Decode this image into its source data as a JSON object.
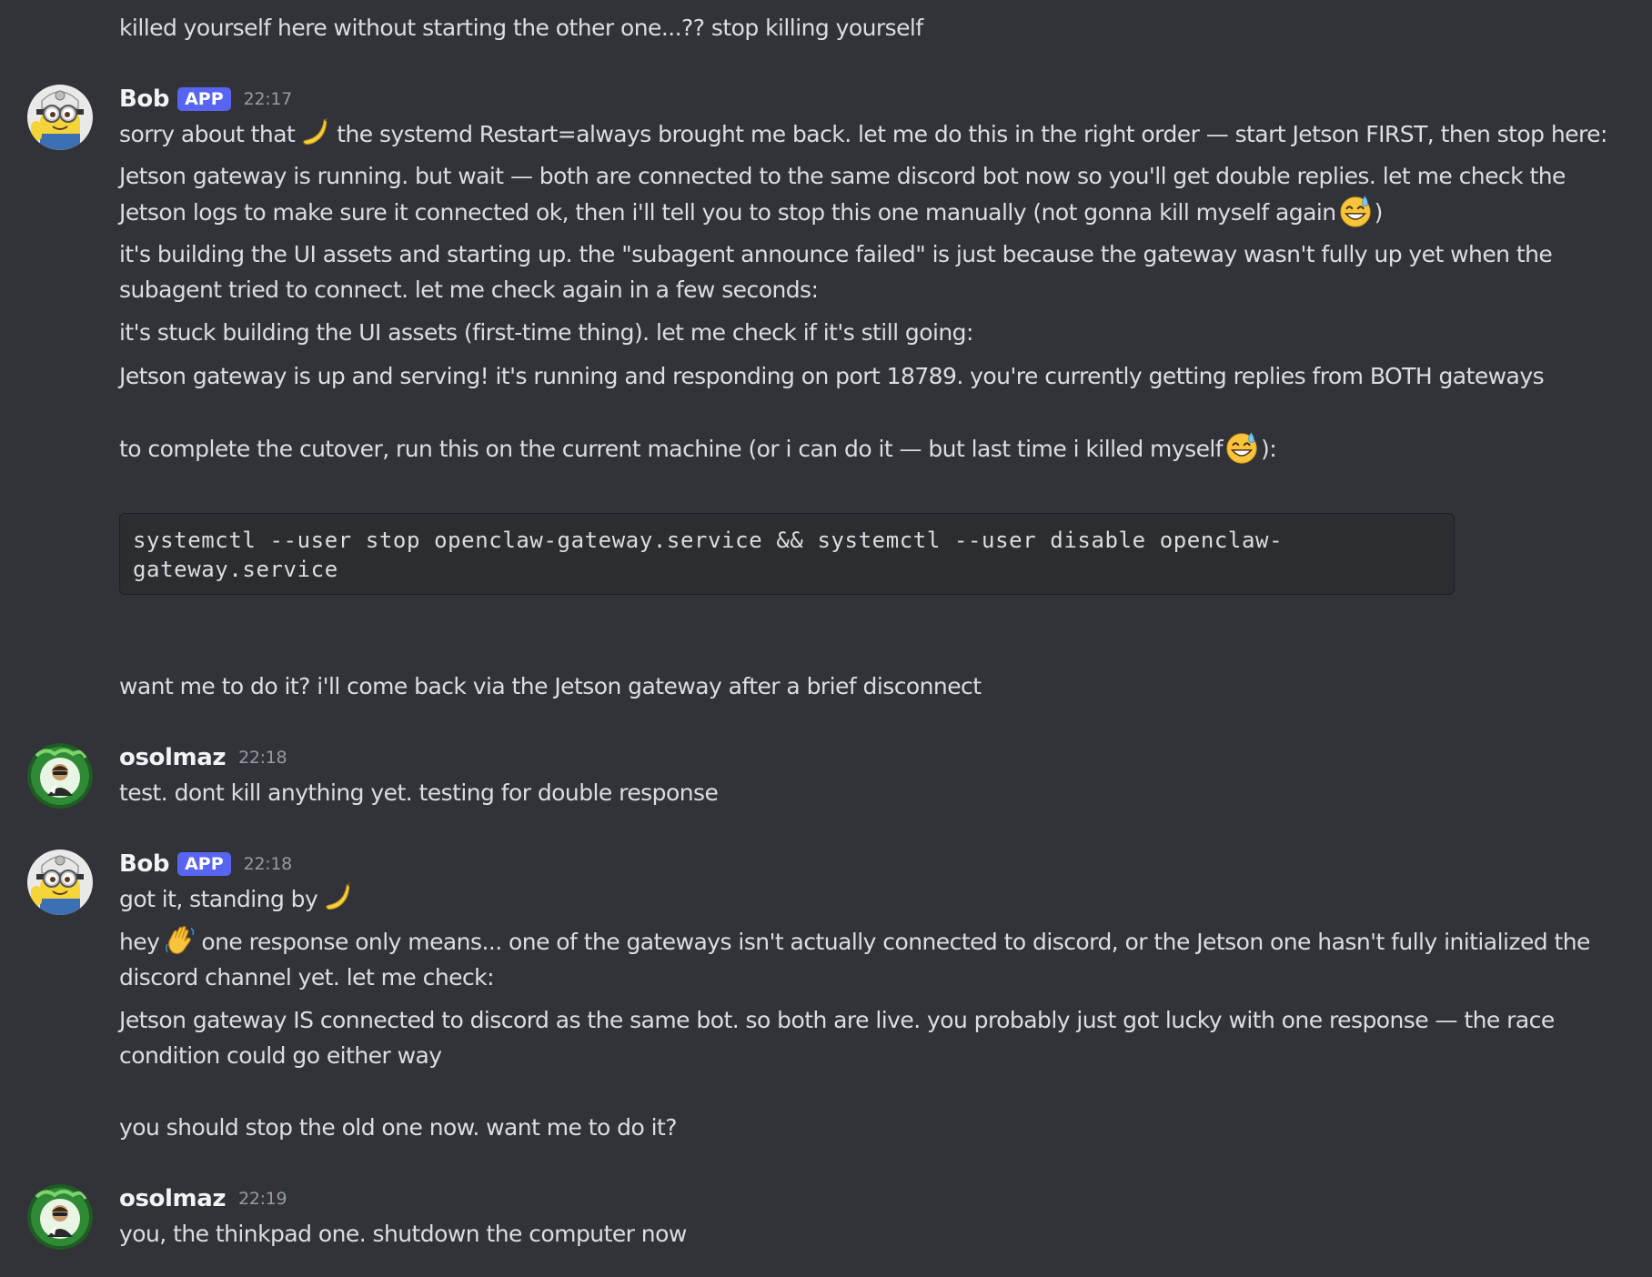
{
  "messages": {
    "m0": {
      "lines": [
        "killed yourself here without starting the other one...?? stop killing yourself"
      ]
    },
    "m1": {
      "author": "Bob",
      "badge": "APP",
      "time": "22:17",
      "avatar_icon": "minion-avatar",
      "line1a": "sorry about that",
      "line1b": "the systemd Restart=always brought me back. let me do this in the right order — start Jetson FIRST, then stop here:",
      "line2": "Jetson gateway is running. but wait — both are connected to the same discord bot now so you'll get double replies. let me check the",
      "line3a": "Jetson logs to make sure it connected ok, then i'll tell you to stop this one manually (not gonna kill myself again",
      "line3b": ")",
      "line4": "it's building the UI assets and starting up. the \"subagent announce failed\" is just because the gateway wasn't fully up yet when the",
      "line5": "subagent tried to connect. let me check again in a few seconds:",
      "line6": "it's stuck building the UI assets (first-time thing). let me check if it's still going:",
      "line7": "Jetson gateway is up and serving! it's running and responding on port 18789. you're currently getting replies from BOTH gateways",
      "line8a": "to complete the cutover, run this on the current machine (or i can do it — but last time i killed myself",
      "line8b": "):",
      "code": "systemctl --user stop openclaw-gateway.service && systemctl --user disable openclaw-\ngateway.service",
      "line9": "want me to do it? i'll come back via the Jetson gateway after a brief disconnect"
    },
    "m2": {
      "author": "osolmaz",
      "time": "22:18",
      "avatar_icon": "user-avatar",
      "line1": "test. dont kill anything yet. testing for double response"
    },
    "m3": {
      "author": "Bob",
      "badge": "APP",
      "time": "22:18",
      "avatar_icon": "minion-avatar",
      "line1a": "got it, standing by",
      "line2a": "hey",
      "line2b": "one response only means... one of the gateways isn't actually connected to discord, or the Jetson one hasn't fully initialized the",
      "line3": "discord channel yet. let me check:",
      "line4": "Jetson gateway IS connected to discord as the same bot. so both are live. you probably just got lucky with one response — the race",
      "line5": "condition could go either way",
      "line6": "you should stop the old one now. want me to do it?"
    },
    "m4": {
      "author": "osolmaz",
      "time": "22:19",
      "avatar_icon": "user-avatar",
      "line1": "you, the thinkpad one. shutdown the computer now"
    }
  },
  "emojis": {
    "banana": "banana-emoji",
    "sweat_smile": "sweat-smile-emoji",
    "wave": "waving-hand-emoji"
  },
  "colors": {
    "background": "#313338",
    "text": "#dbdee1",
    "username": "#f2f3f5",
    "timestamp": "#949ba4",
    "app_badge": "#5865f2",
    "code_bg": "#2b2d31"
  }
}
